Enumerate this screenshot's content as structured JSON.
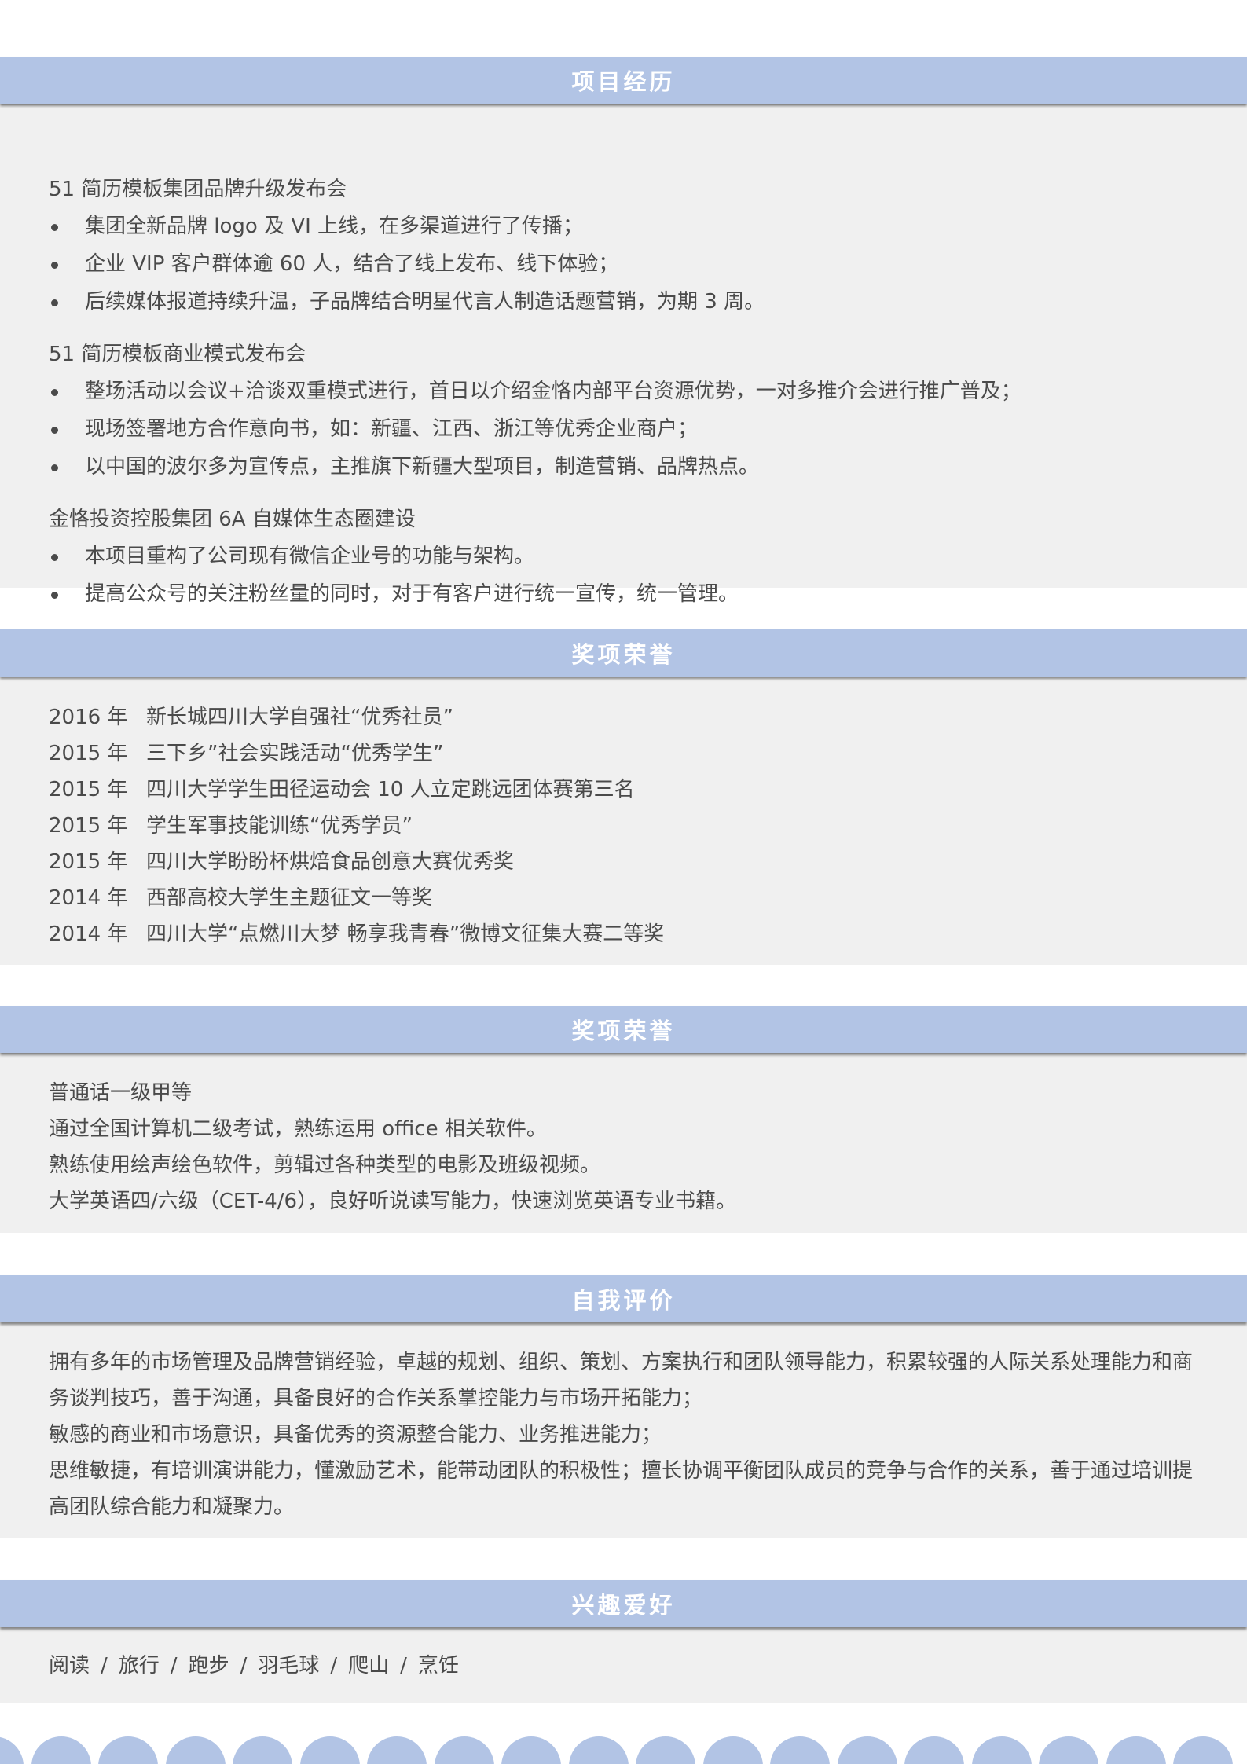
{
  "projects": {
    "title": "项目经历",
    "groups": [
      {
        "name": "51 简历模板集团品牌升级发布会",
        "items": [
          "集团全新品牌 logo 及 VI 上线，在多渠道进行了传播；",
          "企业 VIP 客户群体逾 60 人，结合了线上发布、线下体验；",
          "后续媒体报道持续升温，子品牌结合明星代言人制造话题营销，为期 3 周。"
        ]
      },
      {
        "name": "51 简历模板商业模式发布会",
        "items": [
          "整场活动以会议+洽谈双重模式进行，首日以介绍金恪内部平台资源优势，一对多推介会进行推广普及；",
          "现场签署地方合作意向书，如：新疆、江西、浙江等优秀企业商户；",
          "以中国的波尔多为宣传点，主推旗下新疆大型项目，制造营销、品牌热点。"
        ]
      },
      {
        "name": "金恪投资控股集团 6A 自媒体生态圈建设",
        "items": [
          "本项目重构了公司现有微信企业号的功能与架构。",
          "提高公众号的关注粉丝量的同时，对于有客户进行统一宣传，统一管理。"
        ]
      }
    ]
  },
  "awards": {
    "title": "奖项荣誉",
    "items": [
      {
        "year": "2016 年",
        "text": "新长城四川大学自强社“优秀社员”"
      },
      {
        "year": "2015 年",
        "text": "三下乡”社会实践活动“优秀学生”"
      },
      {
        "year": "2015 年",
        "text": "四川大学学生田径运动会 10 人立定跳远团体赛第三名"
      },
      {
        "year": "2015 年",
        "text": "学生军事技能训练“优秀学员”"
      },
      {
        "year": "2015 年",
        "text": "四川大学盼盼杯烘焙食品创意大赛优秀奖"
      },
      {
        "year": "2014 年",
        "text": "西部高校大学生主题征文一等奖"
      },
      {
        "year": "2014 年",
        "text": "四川大学“点燃川大梦 畅享我青春”微博文征集大赛二等奖"
      }
    ]
  },
  "skills": {
    "title": "奖项荣誉",
    "items": [
      "普通话一级甲等",
      "通过全国计算机二级考试，熟练运用 office 相关软件。",
      "熟练使用绘声绘色软件，剪辑过各种类型的电影及班级视频。",
      "大学英语四/六级（CET-4/6），良好听说读写能力，快速浏览英语专业书籍。"
    ]
  },
  "self_eval": {
    "title": "自我评价",
    "paragraphs": [
      "拥有多年的市场管理及品牌营销经验，卓越的规划、组织、策划、方案执行和团队领导能力，积累较强的人际关系处理能力和商务谈判技巧，善于沟通，具备良好的合作关系掌控能力与市场开拓能力；",
      "敏感的商业和市场意识，具备优秀的资源整合能力、业务推进能力；",
      "思维敏捷，有培训演讲能力，懂激励艺术，能带动团队的积极性；擅长协调平衡团队成员的竞争与合作的关系，善于通过培训提高团队综合能力和凝聚力。"
    ]
  },
  "hobbies": {
    "title": "兴趣爱好",
    "items": [
      "阅读",
      "旅行",
      "跑步",
      "羽毛球",
      "爬山",
      "烹饪"
    ],
    "separator": "/"
  },
  "colors": {
    "header_bg": "#b2c4e5",
    "body_bg": "#f0f0f0",
    "text": "#4a4a4a"
  }
}
